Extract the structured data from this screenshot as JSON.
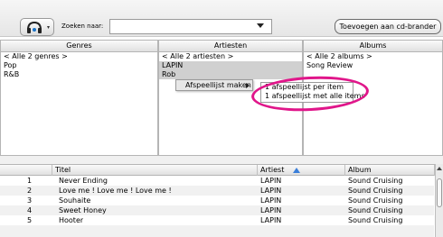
{
  "toolbar": {
    "search_label": "Zoeken naar:",
    "search_value": "",
    "cd_button_label": "Toevoegen aan cd-brander"
  },
  "panes": {
    "genres": {
      "header": "Genres",
      "items": [
        "< Alle 2 genres >",
        "Pop",
        "R&B"
      ]
    },
    "artists": {
      "header": "Artiesten",
      "items": [
        "< Alle 2 artiesten >",
        "LAPIN",
        "Rob"
      ]
    },
    "albums": {
      "header": "Albums",
      "items": [
        "< Alle 2 albums >",
        "Song Review"
      ]
    }
  },
  "context_menu": {
    "item_label": "Afspeellijst maken",
    "submenu": [
      "1 afspeellijst per item",
      "1 afspeellijst met alle items"
    ]
  },
  "table": {
    "columns": [
      "",
      "Titel",
      "Artiest",
      "Album"
    ],
    "rows": [
      {
        "num": "1",
        "title": "Never Ending",
        "artist": "LAPIN",
        "album": "Sound Cruising"
      },
      {
        "num": "2",
        "title": "Love me ! Love me ! Love me !",
        "artist": "LAPIN",
        "album": "Sound Cruising"
      },
      {
        "num": "3",
        "title": "Souhaite",
        "artist": "LAPIN",
        "album": "Sound Cruising"
      },
      {
        "num": "4",
        "title": "Sweet Honey",
        "artist": "LAPIN",
        "album": "Sound Cruising"
      },
      {
        "num": "5",
        "title": "Hooter",
        "artist": "LAPIN",
        "album": "Sound Cruising"
      }
    ]
  },
  "colors": {
    "highlight_ring": "#e0168a",
    "sort_arrow": "#3b7fd9"
  }
}
